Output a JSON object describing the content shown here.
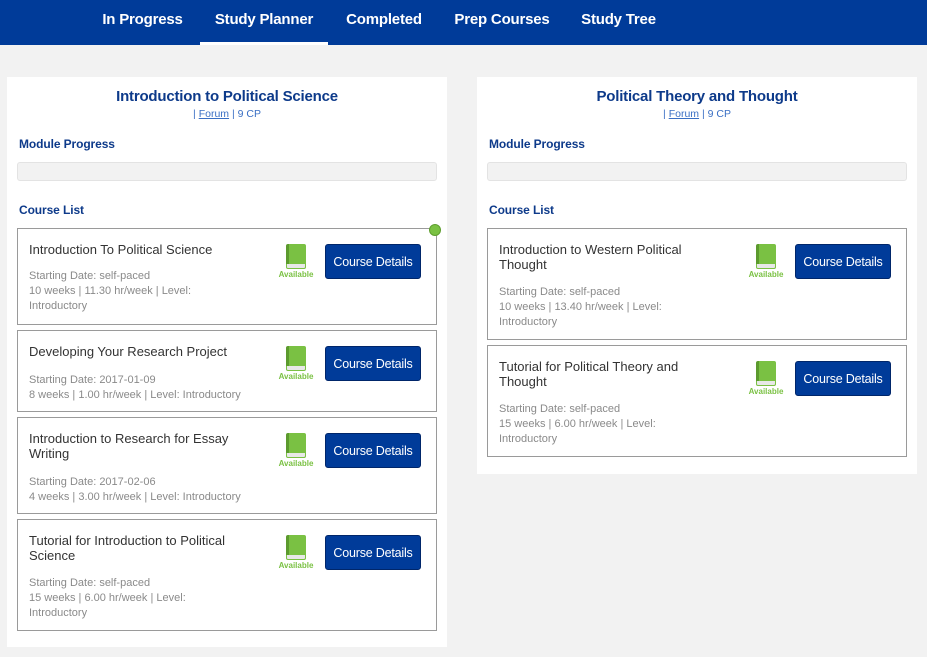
{
  "nav": {
    "tabs": [
      {
        "label": "In Progress"
      },
      {
        "label": "Study Planner",
        "active": true
      },
      {
        "label": "Completed"
      },
      {
        "label": "Prep Courses"
      },
      {
        "label": "Study Tree"
      }
    ]
  },
  "colors": {
    "nav_bg": "#003b99",
    "accent_green": "#7ac143",
    "title_blue": "#0d3a8a"
  },
  "icons": {
    "availability": "book-icon"
  },
  "modules": [
    {
      "title": "Introduction to Political Science",
      "meta_prefix": "| ",
      "forum_label": "Forum",
      "credits": " | 9 CP",
      "progress_label": "Module Progress",
      "progress": 0,
      "course_list_label": "Course List",
      "courses": [
        {
          "title": "Introduction To Political Science",
          "start": "Starting Date: self-paced",
          "details": "10 weeks | 11.30 hr/week | Level: Introductory",
          "status": "Available",
          "button": "Course Details"
        },
        {
          "title": "Developing Your Research Project",
          "start": "Starting Date: 2017-01-09",
          "details": "8 weeks | 1.00 hr/week | Level: Introductory",
          "status": "Available",
          "button": "Course Details"
        },
        {
          "title": "Introduction to Research for Essay Writing",
          "start": "Starting Date: 2017-02-06",
          "details": "4 weeks | 3.00 hr/week | Level: Introductory",
          "status": "Available",
          "button": "Course Details"
        },
        {
          "title": "Tutorial for Introduction to Political Science",
          "start": "Starting Date: self-paced",
          "details": "15 weeks | 6.00 hr/week | Level: Introductory",
          "status": "Available",
          "button": "Course Details"
        }
      ]
    },
    {
      "title": "Political Theory and Thought",
      "meta_prefix": "| ",
      "forum_label": "Forum",
      "credits": " | 9 CP",
      "progress_label": "Module Progress",
      "progress": 0,
      "course_list_label": "Course List",
      "courses": [
        {
          "title": "Introduction to Western Political Thought",
          "start": "Starting Date: self-paced",
          "details": "10 weeks | 13.40 hr/week | Level: Introductory",
          "status": "Available",
          "button": "Course Details"
        },
        {
          "title": "Tutorial for Political Theory and Thought",
          "start": "Starting Date: self-paced",
          "details": "15 weeks | 6.00 hr/week | Level: Introductory",
          "status": "Available",
          "button": "Course Details"
        }
      ]
    }
  ]
}
